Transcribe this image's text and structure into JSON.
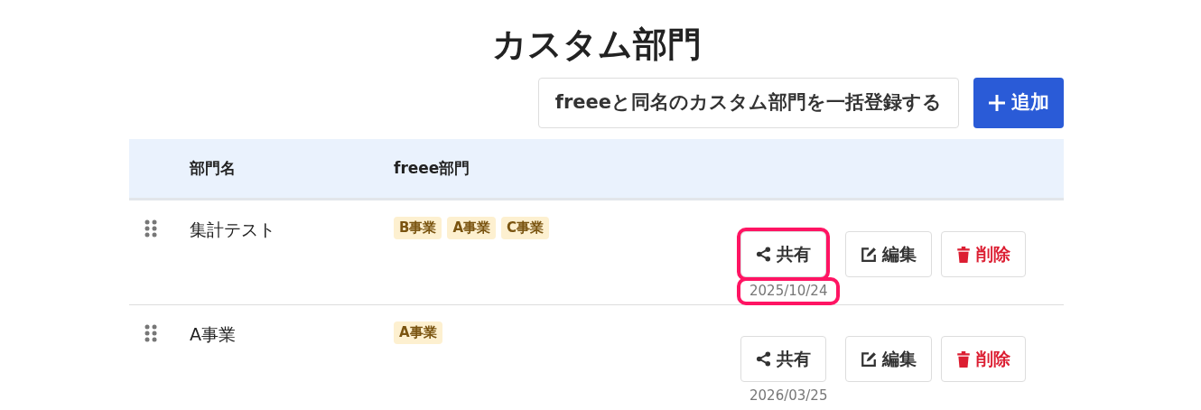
{
  "title": "カスタム部門",
  "toolbar": {
    "bulk_button": "freeeと同名のカスタム部門を一括登録する",
    "add_button": "追加"
  },
  "table": {
    "columns": [
      "部門名",
      "freee部門"
    ],
    "rows": [
      {
        "name": "集計テスト",
        "tags": [
          "B事業",
          "A事業",
          "C事業"
        ],
        "share": "共有",
        "edit": "編集",
        "delete": "削除",
        "date": "2025/10/24",
        "highlighted": true
      },
      {
        "name": "A事業",
        "tags": [
          "A事業"
        ],
        "share": "共有",
        "edit": "編集",
        "delete": "削除",
        "date": "2026/03/25",
        "highlighted": false
      }
    ]
  }
}
